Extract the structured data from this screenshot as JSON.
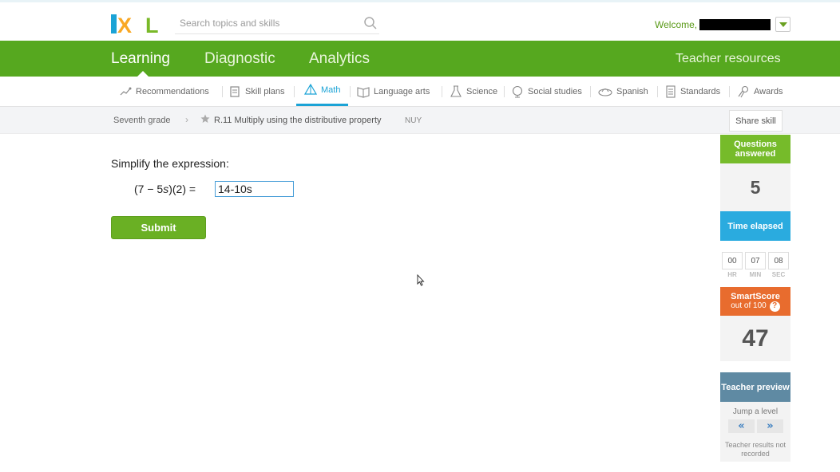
{
  "header": {
    "logo_text": "IXL",
    "search_placeholder": "Search topics and skills",
    "welcome": "Welcome,"
  },
  "main_nav": {
    "items": [
      {
        "label": "Learning",
        "active": true
      },
      {
        "label": "Diagnostic",
        "active": false
      },
      {
        "label": "Analytics",
        "active": false
      }
    ],
    "teacher_resources": "Teacher resources"
  },
  "subject_nav": {
    "items": [
      {
        "label": "Recommendations",
        "icon": "recommendations-icon"
      },
      {
        "label": "Skill plans",
        "icon": "skill-plans-icon"
      },
      {
        "label": "Math",
        "icon": "math-icon",
        "active": true
      },
      {
        "label": "Language arts",
        "icon": "language-arts-icon"
      },
      {
        "label": "Science",
        "icon": "science-icon"
      },
      {
        "label": "Social studies",
        "icon": "social-studies-icon"
      },
      {
        "label": "Spanish",
        "icon": "spanish-icon"
      },
      {
        "label": "Standards",
        "icon": "standards-icon"
      },
      {
        "label": "Awards",
        "icon": "awards-icon"
      }
    ],
    "active_color": "#1ba3d6"
  },
  "breadcrumb": {
    "grade": "Seventh grade",
    "skill": "R.11 Multiply using the distributive property",
    "code": "NUY",
    "share_label": "Share skill"
  },
  "question": {
    "prompt": "Simplify the expression:",
    "expression": "(7 − 5s)(2) =",
    "answer_value": "14-10s",
    "submit_label": "Submit"
  },
  "sidebar": {
    "questions_answered_label": "Questions answered",
    "questions_answered": "5",
    "time_elapsed_label": "Time elapsed",
    "time": {
      "hr": "00",
      "min": "07",
      "sec": "08"
    },
    "time_labels": {
      "hr": "HR",
      "min": "MIN",
      "sec": "SEC"
    },
    "smartscore_label": "SmartScore",
    "smartscore_sub": "out of 100",
    "smartscore": "47",
    "teacher_preview_label": "Teacher preview",
    "jump_label": "Jump a level",
    "jump_back": "«",
    "jump_forward": "»",
    "teacher_note": "Teacher results not recorded"
  },
  "colors": {
    "brand_green": "#56a81f",
    "qa_green": "#76bb2a",
    "time_blue": "#2aabdf",
    "smartscore_orange": "#e86c2e",
    "teacher_slate": "#5f8aa3"
  }
}
